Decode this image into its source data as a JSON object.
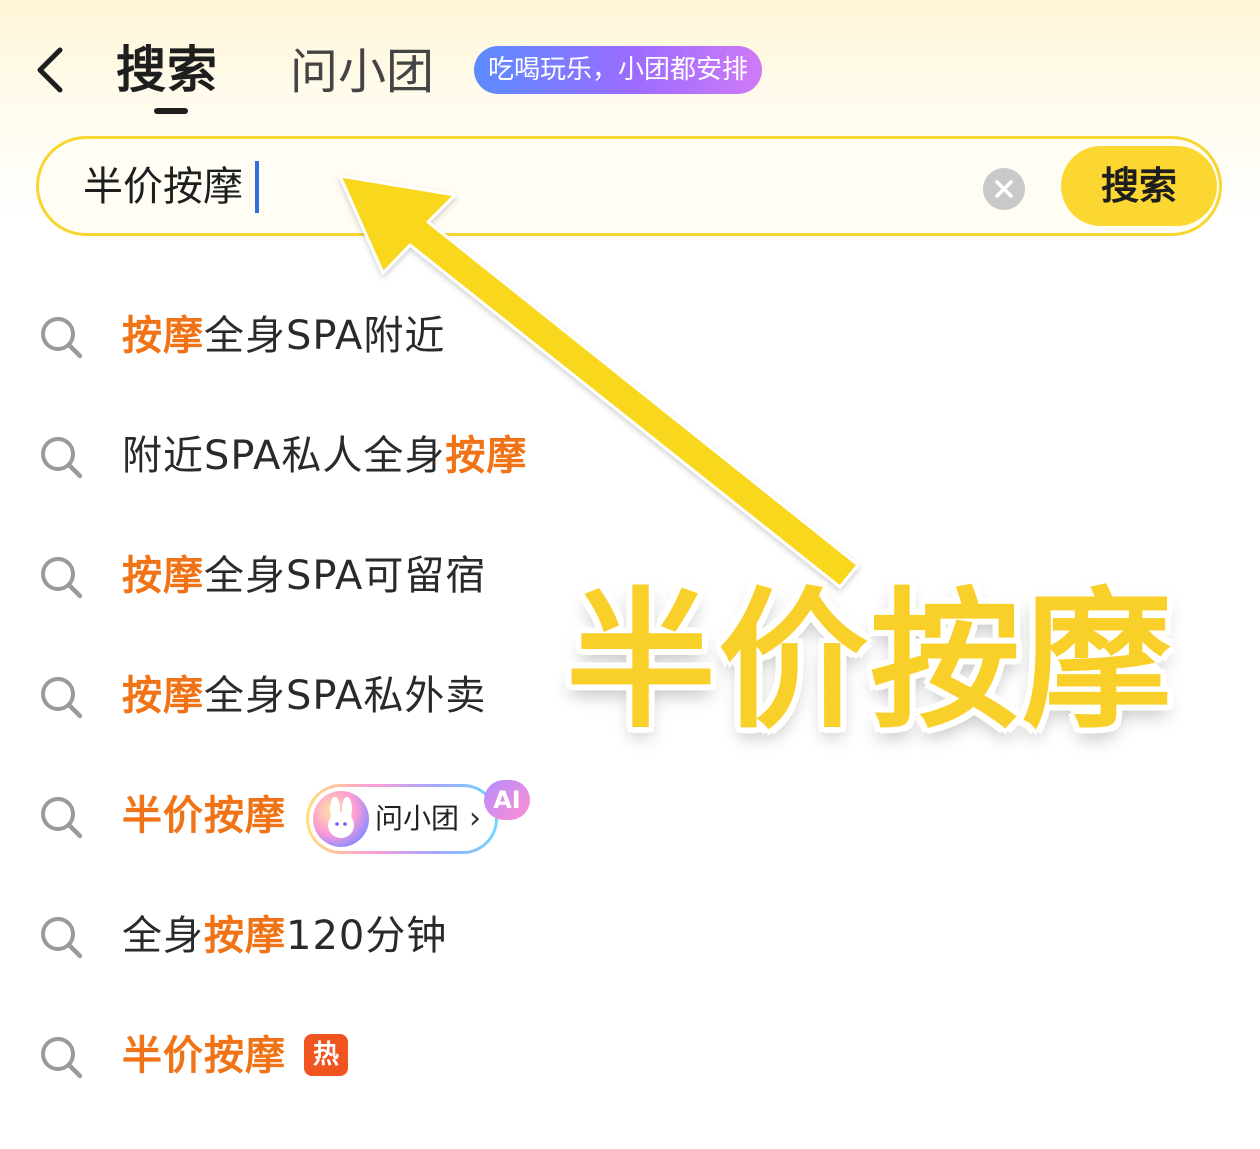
{
  "header": {
    "tab_search": "搜索",
    "tab_ask": "问小团",
    "promo_badge": "吃喝玩乐，小团都安排"
  },
  "search": {
    "query": "半价按摩",
    "button_label": "搜索"
  },
  "suggestions": [
    {
      "highlight": "按摩",
      "rest": "全身SPA附近"
    },
    {
      "prefix": "附近SPA私人全身",
      "highlight": "按摩"
    },
    {
      "highlight": "按摩",
      "rest": "全身SPA可留宿"
    },
    {
      "highlight": "按摩",
      "rest": "全身SPA私外卖"
    },
    {
      "highlight": "半价按摩",
      "chip_label": "问小团",
      "chip_arrow": "›",
      "ai_tag": "AI"
    },
    {
      "prefix": "全身",
      "highlight": "按摩",
      "rest": "120分钟"
    },
    {
      "highlight": "半价按摩",
      "badge": "热"
    }
  ],
  "overlay": {
    "caption": "半价按摩",
    "arrow_color": "#f9d71c",
    "caption_color": "#f9cf2a"
  },
  "colors": {
    "accent_yellow": "#fcd731",
    "highlight_orange": "#f07417",
    "hot_red": "#f0541f",
    "caret_blue": "#2f6fe0"
  },
  "icons": [
    "back-arrow-icon",
    "clear-icon",
    "search-icon"
  ]
}
